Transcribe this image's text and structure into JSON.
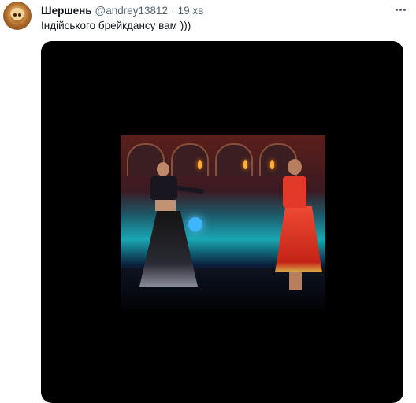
{
  "tweet": {
    "display_name": "Шершень",
    "handle": "@andrey13812",
    "separator": "·",
    "time": "19 хв",
    "text": "Індійського брейкдансу вам )))"
  },
  "icons": {
    "avatar": "hornet-avatar",
    "more": "more-dots-icon"
  },
  "colors": {
    "name": "#0f1419",
    "meta": "#536471",
    "media_background": "#000000"
  }
}
